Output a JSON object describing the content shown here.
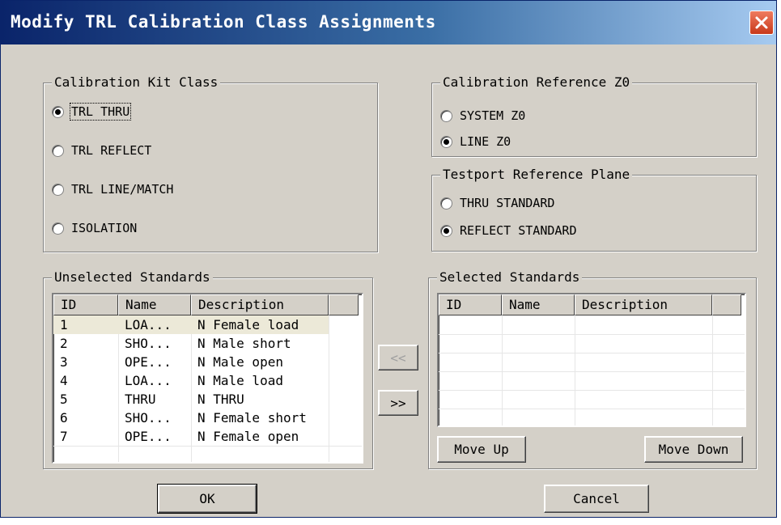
{
  "window": {
    "title": "Modify TRL Calibration Class Assignments",
    "close_icon": "close-icon"
  },
  "kit_class": {
    "legend": "Calibration Kit Class",
    "options": [
      {
        "label": "TRL THRU",
        "checked": true
      },
      {
        "label": "TRL REFLECT",
        "checked": false
      },
      {
        "label": "TRL LINE/MATCH",
        "checked": false
      },
      {
        "label": "ISOLATION",
        "checked": false
      }
    ]
  },
  "ref_z0": {
    "legend": "Calibration Reference Z0",
    "options": [
      {
        "label": "SYSTEM Z0",
        "checked": false
      },
      {
        "label": "LINE Z0",
        "checked": true
      }
    ]
  },
  "ref_plane": {
    "legend": "Testport Reference Plane",
    "options": [
      {
        "label": "THRU STANDARD",
        "checked": false
      },
      {
        "label": "REFLECT STANDARD",
        "checked": true
      }
    ]
  },
  "unselected": {
    "legend": "Unselected Standards",
    "columns": [
      "ID",
      "Name",
      "Description"
    ],
    "rows": [
      [
        "1",
        "LOA...",
        "N Female load"
      ],
      [
        "2",
        "SHO...",
        "N Male short"
      ],
      [
        "3",
        "OPE...",
        "N Male open"
      ],
      [
        "4",
        "LOA...",
        "N Male load"
      ],
      [
        "5",
        "THRU",
        "N THRU"
      ],
      [
        "6",
        "SHO...",
        "N Female short"
      ],
      [
        "7",
        "OPE...",
        "N Female open"
      ]
    ]
  },
  "selected": {
    "legend": "Selected Standards",
    "columns": [
      "ID",
      "Name",
      "Description"
    ],
    "rows": []
  },
  "buttons": {
    "remove": "<<",
    "add": ">>",
    "move_up": "Move Up",
    "move_down": "Move Down",
    "ok": "OK",
    "cancel": "Cancel"
  }
}
